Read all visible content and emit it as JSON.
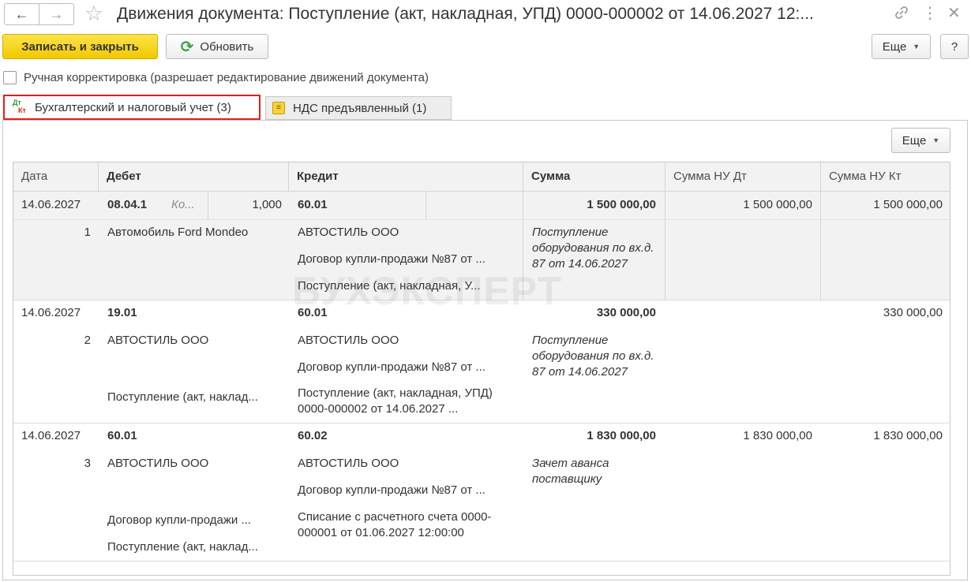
{
  "window": {
    "title": "Движения документа: Поступление (акт, накладная, УПД) 0000-000002 от 14.06.2027 12:...",
    "icons": [
      "back-arrow-icon",
      "forward-arrow-icon",
      "star-icon",
      "link-icon",
      "menu-dots-icon",
      "close-icon"
    ]
  },
  "toolbar": {
    "save_close_label": "Записать и закрыть",
    "refresh_label": "Обновить",
    "more_label": "Еще",
    "help_label": "?"
  },
  "manual_correction": {
    "label": "Ручная корректировка (разрешает редактирование движений документа)",
    "checked": false
  },
  "tabs": [
    {
      "label": "Бухгалтерский и налоговый учет (3)",
      "icon": "dt-kt-icon",
      "active": true
    },
    {
      "label": "НДС предъявленный (1)",
      "icon": "register-icon",
      "active": false
    }
  ],
  "icon_text": {
    "dt": "Дт",
    "kt": "Кт",
    "nds": "≡"
  },
  "panel": {
    "more_label": "Еще"
  },
  "table": {
    "headers": [
      "Дата",
      "Дебет",
      "Кредит",
      "Сумма",
      "Сумма НУ Дт",
      "Сумма НУ Кт"
    ],
    "rows": [
      {
        "date": "14.06.2027",
        "num": "1",
        "debit_account": "08.04.1",
        "debit_qty_label": "Ко...",
        "debit_qty": "1,000",
        "debit_sub": [
          "Автомобиль Ford Mondeo"
        ],
        "credit_account": "60.01",
        "credit_sub": [
          "АВТОСТИЛЬ ООО",
          "Договор купли-продажи №87 от ...",
          "Поступление (акт, накладная, У..."
        ],
        "sum": "1 500 000,00",
        "content": "Поступление оборудования по вх.д. 87 от 14.06.2027",
        "nu_dt": "1 500 000,00",
        "nu_kt": "1 500 000,00",
        "selected": true
      },
      {
        "date": "14.06.2027",
        "num": "2",
        "debit_account": "19.01",
        "debit_sub": [
          "АВТОСТИЛЬ ООО",
          "Поступление (акт, наклад..."
        ],
        "credit_account": "60.01",
        "credit_sub": [
          "АВТОСТИЛЬ ООО",
          "Договор купли-продажи №87 от ...",
          "Поступление (акт, накладная, УПД) 0000-000002 от 14.06.2027 ..."
        ],
        "sum": "330 000,00",
        "content": "Поступление оборудования по вх.д. 87 от 14.06.2027",
        "nu_dt": "",
        "nu_kt": "330 000,00",
        "selected": false
      },
      {
        "date": "14.06.2027",
        "num": "3",
        "debit_account": "60.01",
        "debit_sub": [
          "АВТОСТИЛЬ ООО",
          "Договор купли-продажи ...",
          "Поступление (акт, наклад..."
        ],
        "credit_account": "60.02",
        "credit_sub": [
          "АВТОСТИЛЬ ООО",
          "Договор купли-продажи №87 от ...",
          "Списание с расчетного счета 0000-000001 от 01.06.2027 12:00:00"
        ],
        "sum": "1 830 000,00",
        "content": "Зачет аванса поставщику",
        "nu_dt": "1 830 000,00",
        "nu_kt": "1 830 000,00",
        "selected": false
      }
    ]
  },
  "watermark": "БУХЭКСПЕРТ"
}
